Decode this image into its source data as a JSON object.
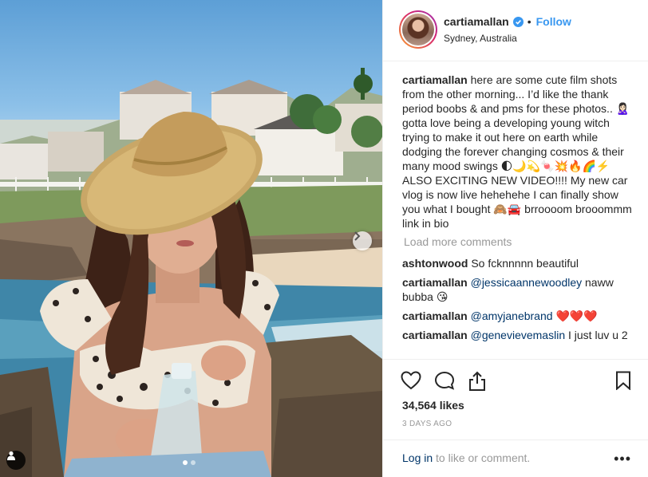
{
  "post": {
    "username": "cartiamallan",
    "separator": "•",
    "follow_label": "Follow",
    "location": "Sydney, Australia",
    "caption_author": "cartiamallan",
    "caption_text": "here are some cute film shots from the other morning... I’d like the thank period boobs & and pms for these photos.. 🙎🏻‍♀️ gotta love being a developing young witch trying to make it out here on earth while dodging the forever changing cosmos & their many mood swings 🌓🌙💫🍬💥🔥🌈⚡️ ALSO EXCITING NEW VIDEO!!!! My new car vlog is now live hehehehe I can finally show you what I bought 🙈🚘 brroooom brooommm link in bio",
    "load_more": "Load more comments",
    "comments": [
      {
        "author": "ashtonwood",
        "mention": "",
        "text": "So fcknnnnn beautiful"
      },
      {
        "author": "cartiamallan",
        "mention": "@jessicaannewoodley",
        "text": "naww bubba 😘"
      },
      {
        "author": "cartiamallan",
        "mention": "@amyjanebrand",
        "text": "❤️❤️❤️"
      },
      {
        "author": "cartiamallan",
        "mention": "@genevievemaslin",
        "text": "I just luv u 2"
      }
    ],
    "likes": "34,564 likes",
    "date": "3 DAYS AGO",
    "login_link": "Log in",
    "login_rest": " to like or comment.",
    "more_label": "•••"
  },
  "carousel": {
    "total": 2,
    "active_index": 0
  },
  "icons": {
    "verified": "verified-badge-icon",
    "like": "heart-icon",
    "comment": "comment-icon",
    "share": "share-icon",
    "save": "bookmark-icon",
    "next": "chevron-right-icon",
    "tag": "user-tag-icon"
  },
  "colors": {
    "accent": "#3897f0",
    "mention": "#003569",
    "muted": "#999999",
    "text": "#262626"
  }
}
